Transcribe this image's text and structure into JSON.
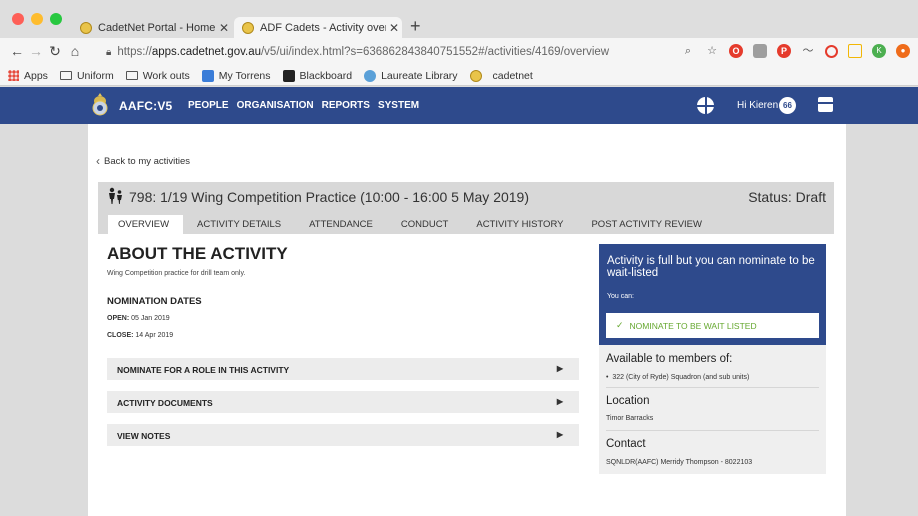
{
  "browser": {
    "tabs": [
      {
        "title": "CadetNet Portal - Home",
        "active": false
      },
      {
        "title": "ADF Cadets - Activity overview",
        "active": true
      }
    ],
    "new_tab": "+",
    "url_prefix": "https://",
    "url_domain": "apps.cadetnet.gov.au",
    "url_rest": "/v5/ui/index.html?s=636862843840751552#/activities/4169/overview",
    "bookmarks": [
      "Apps",
      "Uniform",
      "Work outs",
      "My Torrens",
      "Blackboard",
      "Laureate Library",
      "cadetnet"
    ],
    "profile_initial": "K"
  },
  "app": {
    "brand": "AAFC:V5",
    "nav": [
      "PEOPLE",
      "ORGANISATION",
      "REPORTS",
      "SYSTEM"
    ],
    "greeting": "Hi Kieren",
    "badge_count": "66"
  },
  "page": {
    "back_link": "Back to my activities",
    "activity_title": "798: 1/19 Wing Competition Practice (10:00 - 16:00 5 May 2019)",
    "status": "Status: Draft",
    "tabs": [
      "OVERVIEW",
      "ACTIVITY DETAILS",
      "ATTENDANCE",
      "CONDUCT",
      "ACTIVITY HISTORY",
      "POST ACTIVITY REVIEW"
    ],
    "active_tab": "OVERVIEW",
    "about_title": "ABOUT THE ACTIVITY",
    "about_desc": "Wing Competition practice for drill team only.",
    "nomination_title": "NOMINATION DATES",
    "open_label": "OPEN:",
    "open_value": "05 Jan 2019",
    "close_label": "CLOSE:",
    "close_value": "14 Apr 2019",
    "accordions": [
      "NOMINATE FOR A ROLE IN THIS ACTIVITY",
      "ACTIVITY DOCUMENTS",
      "VIEW NOTES"
    ]
  },
  "sidebar": {
    "alert_title": "Activity is full but you can nominate to be wait-listed",
    "alert_sub": "You can:",
    "nominate_button": "NOMINATE TO BE WAIT LISTED",
    "members_heading": "Available to members of:",
    "members_item": "322 (City of Ryde) Squadron (and sub units)",
    "location_heading": "Location",
    "location_value": "Timor Barracks",
    "contact_heading": "Contact",
    "contact_value": "SQNLDR(AAFC) Merridy Thompson - 8022103"
  },
  "colors": {
    "header_blue": "#2e4a8c",
    "nominate_green": "#66a830"
  }
}
